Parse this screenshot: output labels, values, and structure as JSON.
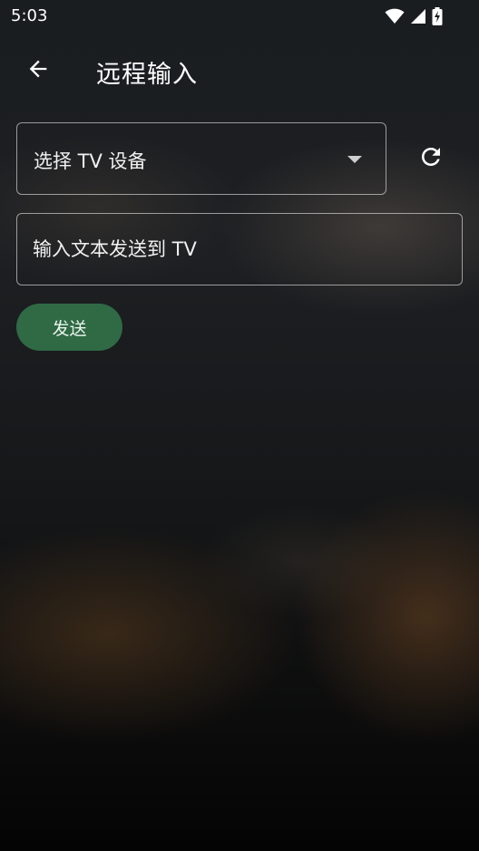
{
  "status_bar": {
    "time": "5:03",
    "icons": [
      "wifi-icon",
      "cell-signal-icon",
      "battery-charging-icon"
    ]
  },
  "app_bar": {
    "back_icon": "arrow-back-icon",
    "title": "远程输入"
  },
  "device_select": {
    "selected_label": "选择 TV 设备",
    "arrow_icon": "dropdown-arrow-icon"
  },
  "refresh_icon": "refresh-icon",
  "text_input": {
    "value": "",
    "placeholder": "输入文本发送到 TV"
  },
  "send_button": {
    "label": "发送"
  },
  "colors": {
    "accent_button": "#2f6a45",
    "outline": "#8c8f92",
    "text": "#f1f1f1"
  }
}
